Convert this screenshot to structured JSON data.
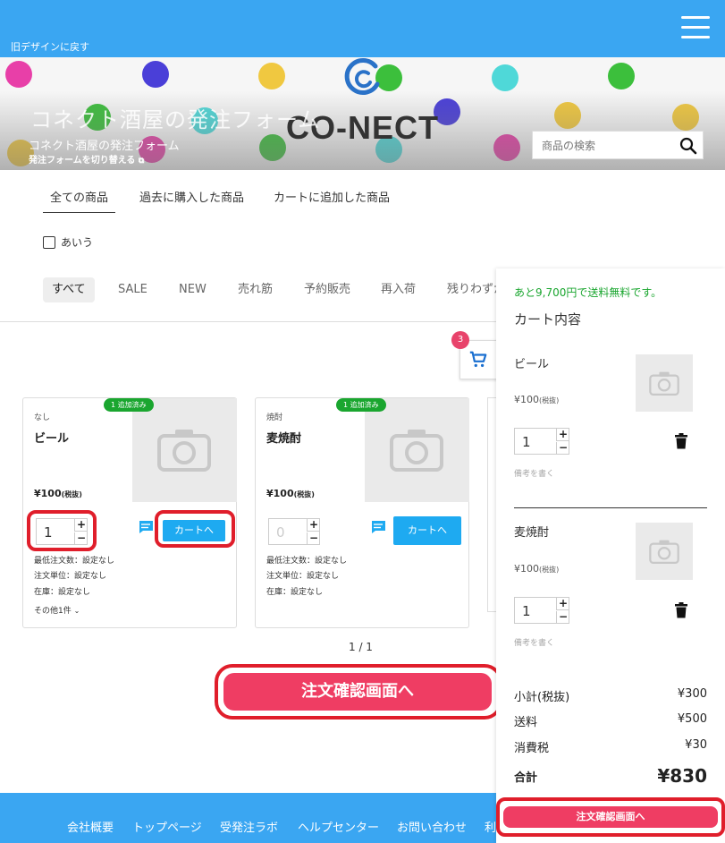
{
  "header": {
    "old_design_link": "旧デザインに戻す",
    "menu_icon": "hamburger-menu-icon",
    "brand_color": "#3aa6f2"
  },
  "hero": {
    "logo_text": "CO-NECT",
    "shop_title_large": "コネクト酒屋の発注フォーム",
    "shop_title": "コネクト酒屋の発注フォーム",
    "switch_form": "発注フォームを切り替える",
    "search_placeholder": "商品の検索"
  },
  "tabs": [
    "全ての商品",
    "過去に購入した商品",
    "カートに追加した商品"
  ],
  "checkbox_label": "あいう",
  "filters": [
    "すべて",
    "SALE",
    "NEW",
    "売れ筋",
    "予約販売",
    "再入荷",
    "残りわずか"
  ],
  "cart_badge_count": "3",
  "products": [
    {
      "category": "なし",
      "name": "ビール",
      "price": "¥100",
      "tax_note": "(税抜)",
      "badge": "1 追加済み",
      "qty": "1",
      "cart_button": "カートへ",
      "min_order": "最低注文数：設定なし",
      "unit": "注文単位：設定なし",
      "stock": "在庫：設定なし",
      "more": "その他1件"
    },
    {
      "category": "焼酎",
      "name": "麦焼酎",
      "price": "¥100",
      "tax_note": "(税抜)",
      "badge": "1 追加済み",
      "qty": "0",
      "cart_button": "カートへ",
      "min_order": "最低注文数：設定なし",
      "unit": "注文単位：設定なし",
      "stock": "在庫：設定なし"
    }
  ],
  "pager": "1 / 1",
  "order_button": "注文確認画面へ",
  "cart_panel": {
    "free_shipping": "あと9,700円で送料無料です。",
    "title": "カート内容",
    "items": [
      {
        "name": "ビール",
        "price": "¥100",
        "tax_note": "(税抜)",
        "qty": "1",
        "note": "備考を書く"
      },
      {
        "name": "麦焼酎",
        "price": "¥100",
        "tax_note": "(税抜)",
        "qty": "1",
        "note": "備考を書く"
      }
    ],
    "subtotal_label": "小計(税抜)",
    "subtotal": "¥300",
    "shipping_label": "送料",
    "shipping": "¥500",
    "tax_label": "消費税",
    "tax": "¥30",
    "total_label": "合計",
    "total": "¥830",
    "order_button": "注文確認画面へ"
  },
  "footer": {
    "links": [
      "会社概要",
      "トップページ",
      "受発注ラボ",
      "ヘルプセンター",
      "お問い合わせ",
      "利"
    ]
  }
}
